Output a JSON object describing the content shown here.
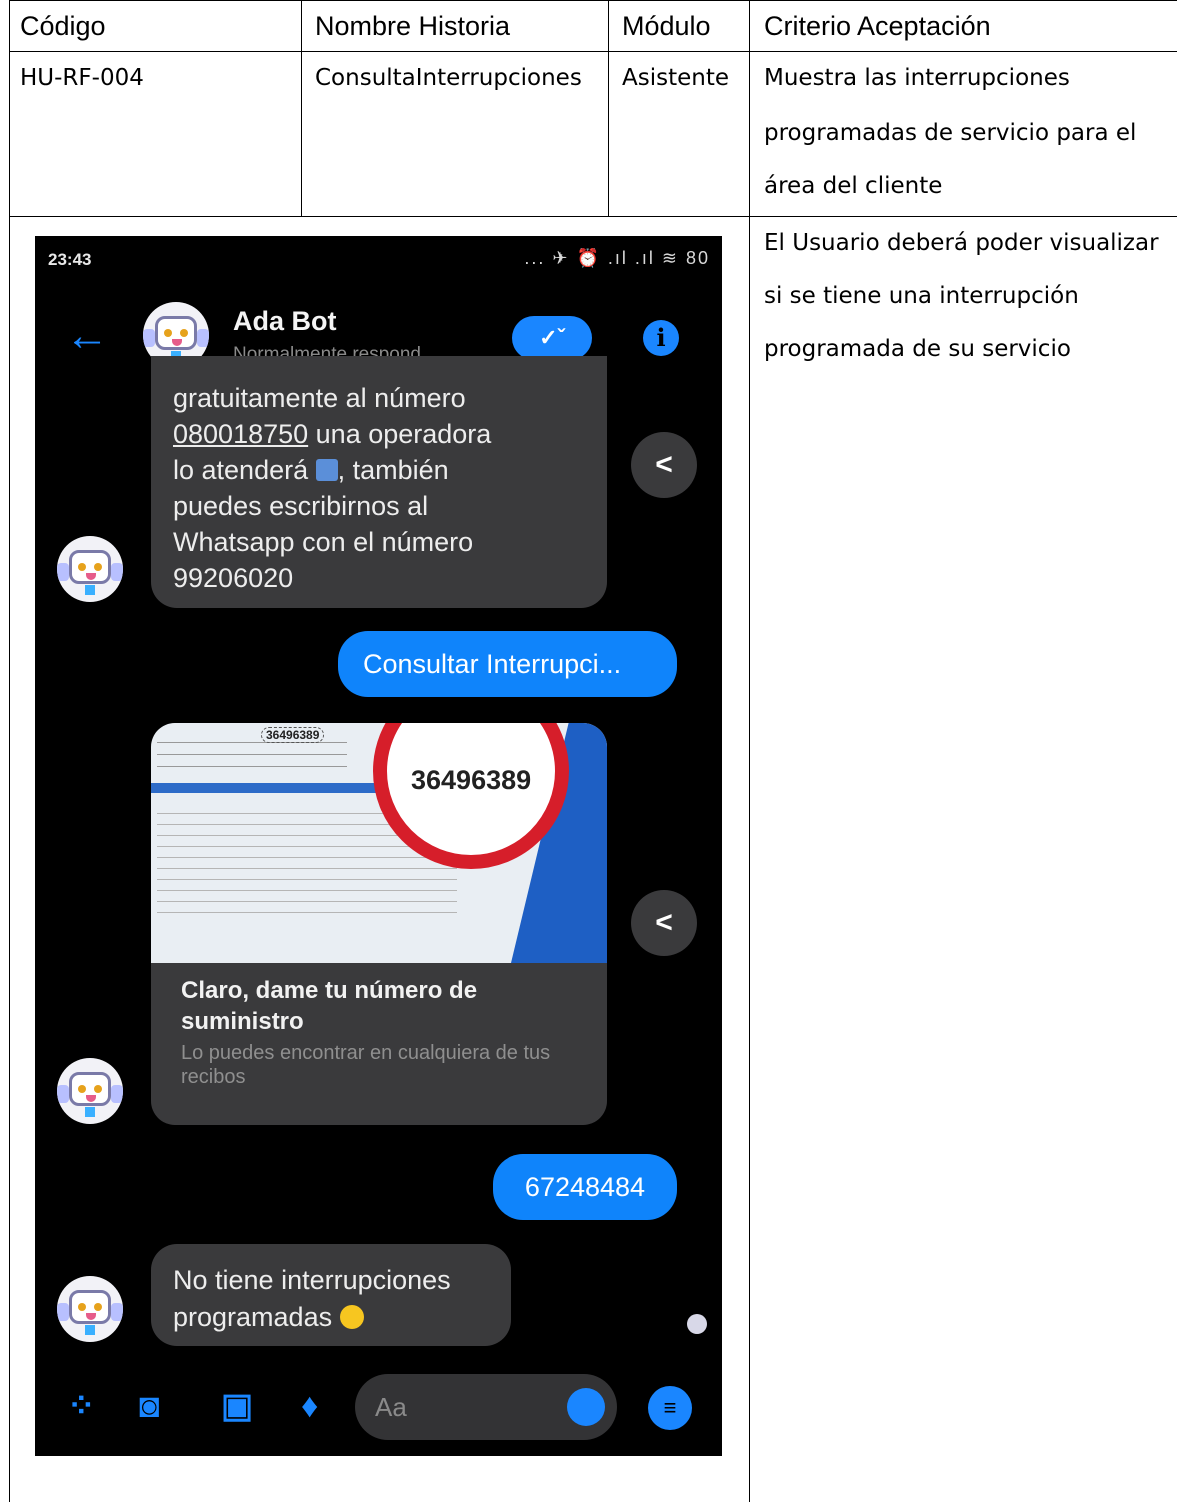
{
  "table": {
    "headers": [
      "Código",
      "Nombre Historia",
      "Módulo",
      "Criterio Aceptación"
    ],
    "row": {
      "codigo": "HU-RF-004",
      "nombre": "ConsultaInterrupciones",
      "modulo": "Asistente",
      "criterio_lines": [
        "Muestra las interrupciones",
        "programadas de servicio para el",
        "área del cliente"
      ]
    },
    "second_row_criteria_lines": [
      "El Usuario deberá poder visualizar",
      "si se tiene una interrupción",
      "programada de su servicio"
    ]
  },
  "phone": {
    "status_time": "23:43",
    "status_icons": "... ✈ ⏰ .ıl .ıl ≋ 80",
    "bot_name": "Ada Bot",
    "bot_status": "Normalmente respond...",
    "check_label": "✓ˇ",
    "info_label": "i",
    "back_icon": "←",
    "share_icon": "<",
    "messages": {
      "bot_1_lines": [
        "gratuitamente al número",
        "080018750",
        " una operadora",
        "lo atenderá",
        ", también",
        "puedes escribirnos al",
        "Whatsapp con el número",
        "99206020"
      ],
      "user_1": "Consultar Interrupci...",
      "card_title": "Claro, dame tu número de suministro",
      "card_subtitle": "Lo puedes encontrar en cualquiera de tus recibos",
      "card_image_number": "36496389",
      "user_2": "67248484",
      "bot_2_lines": [
        "No tiene interrupciones",
        "programadas"
      ]
    },
    "composer_placeholder": "Aa",
    "accent_color": "#0f84fb"
  }
}
